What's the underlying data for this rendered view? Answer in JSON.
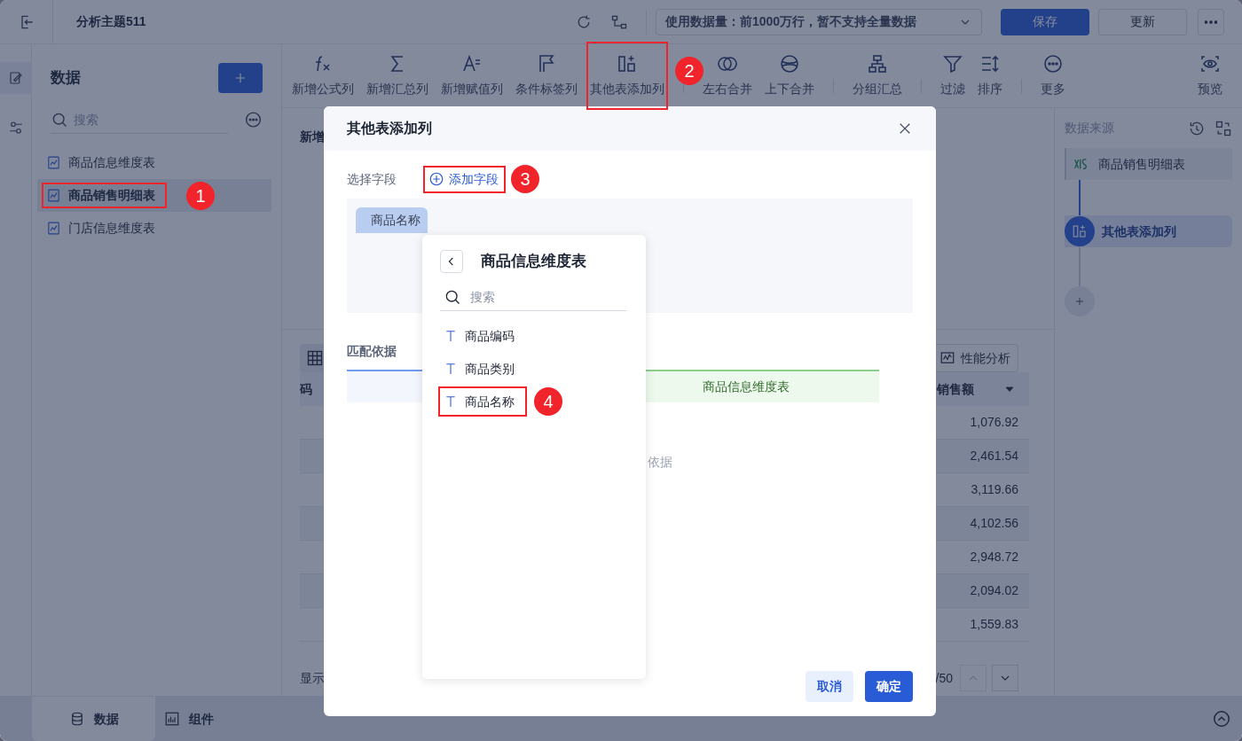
{
  "topbar": {
    "title": "分析主题511",
    "data_limit": "使用数据量：前1000万行，暂不支持全量数据",
    "buttons": [
      {
        "label": "保存",
        "kind": "primary"
      },
      {
        "label": "更新",
        "kind": "default"
      }
    ]
  },
  "data_panel": {
    "title": "数据",
    "search_placeholder": "搜索",
    "tables": [
      {
        "label": "商品信息维度表",
        "selected": false
      },
      {
        "label": "商品销售明细表",
        "selected": true,
        "annotation": "1"
      },
      {
        "label": "门店信息维度表",
        "selected": false
      }
    ]
  },
  "toolbar": {
    "groups": [
      [
        {
          "label": "新增公式列"
        },
        {
          "label": "新增汇总列"
        },
        {
          "label": "新增赋值列"
        },
        {
          "label": "条件标签列"
        },
        {
          "label": "其他表添加列",
          "annotation": "2"
        }
      ],
      [
        {
          "label": "左右合并"
        },
        {
          "label": "上下合并"
        }
      ],
      [
        {
          "label": "分组汇总"
        }
      ],
      [
        {
          "label": "过滤"
        },
        {
          "label": "排序"
        }
      ],
      [
        {
          "label": "更多"
        }
      ]
    ],
    "preview": "预览"
  },
  "workspace": {
    "section_title": "新增",
    "perf_button": "性能分析",
    "column_fragment": "码",
    "sales_header": "销售额",
    "values": [
      "1,076.92",
      "2,461.54",
      "3,119.66",
      "4,102.56",
      "2,948.72",
      "2,094.02",
      "1,559.83"
    ],
    "footer_label": "显示",
    "page_total": "/50"
  },
  "source_panel": {
    "title": "数据来源",
    "steps": [
      {
        "label": "商品销售明细表",
        "kind": "source",
        "selected": false
      },
      {
        "label": "其他表添加列",
        "kind": "step",
        "selected": true
      }
    ]
  },
  "bottom_tabs": [
    {
      "label": "数据",
      "selected": true
    },
    {
      "label": "组件",
      "selected": false
    }
  ],
  "dialog": {
    "title": "其他表添加列",
    "field_label": "选择字段",
    "add_field": {
      "label": "添加字段",
      "annotation": "3"
    },
    "chip": "商品名称",
    "match_label": "匹配依据",
    "match_right_header": "商品信息维度表",
    "empty_text": "依据",
    "buttons": [
      {
        "label": "取消",
        "kind": "default"
      },
      {
        "label": "确定",
        "kind": "primary"
      }
    ]
  },
  "field_picker": {
    "title": "商品信息维度表",
    "search_placeholder": "搜索",
    "fields": [
      {
        "label": "商品编码"
      },
      {
        "label": "商品类别"
      },
      {
        "label": "商品名称",
        "annotation": "4"
      }
    ]
  }
}
